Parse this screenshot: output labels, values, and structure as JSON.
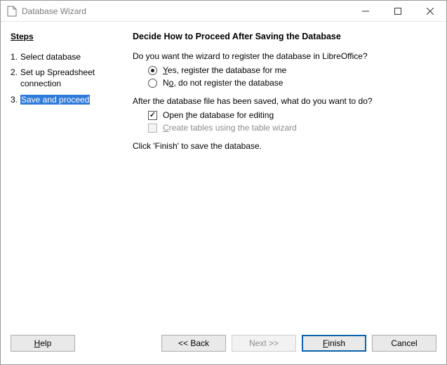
{
  "window": {
    "title": "Database Wizard"
  },
  "sidebar": {
    "heading": "Steps",
    "items": [
      {
        "num": "1.",
        "label": "Select database"
      },
      {
        "num": "2.",
        "label": "Set up Spreadsheet connection"
      },
      {
        "num": "3.",
        "label": "Save and proceed"
      }
    ],
    "active_index": 2
  },
  "main": {
    "heading": "Decide How to Proceed After Saving the Database",
    "q1": "Do you want the wizard to register the database in LibreOffice?",
    "opt_yes_pre": "Y",
    "opt_yes_rest": "es, register the database for me",
    "opt_no_pre": "N",
    "opt_no_u": "o",
    "opt_no_rest": ", do not register the database",
    "q2": "After the database file has been saved, what do you want to do?",
    "chk_open_pre": "Open ",
    "chk_open_u": "t",
    "chk_open_rest": "he database for editing",
    "chk_tables_u": "C",
    "chk_tables_rest": "reate tables using the table wizard",
    "hint": "Click 'Finish' to save the database."
  },
  "footer": {
    "help_u": "H",
    "help_rest": "elp",
    "back": "<< Back",
    "next": "Next >>",
    "finish_u": "F",
    "finish_rest": "inish",
    "cancel": "Cancel"
  }
}
